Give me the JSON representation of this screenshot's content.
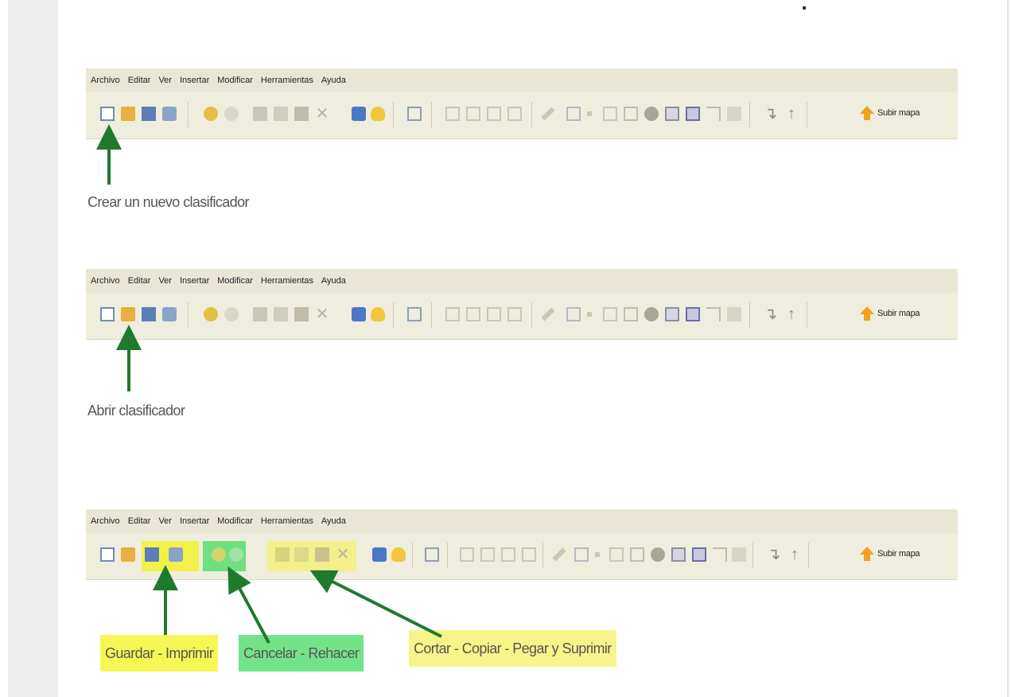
{
  "menu": [
    "Archivo",
    "Editar",
    "Ver",
    "Insertar",
    "Modificar",
    "Herramientas",
    "Ayuda"
  ],
  "toolbar": {
    "subir_label": "Subir mapa"
  },
  "captions": {
    "crear": "Crear un nuevo clasificador",
    "abrir": "Abrir clasificador",
    "guardar": "Guardar - Imprimir",
    "cancelar": "Cancelar - Rehacer",
    "cortar": "Cortar  - Copiar - Pegar y Suprimir"
  },
  "colors": {
    "highlight_yellow": "#f1f14a",
    "highlight_green": "#6fe07f",
    "highlight_pale_yellow": "#f3ef8a",
    "arrow_green": "#1f7a2e",
    "toolbar_bg": "#efeddd"
  },
  "icons": [
    "new-icon",
    "open-folder-icon",
    "save-icon",
    "print-icon",
    "undo-icon",
    "redo-icon",
    "cut-icon",
    "copy-icon",
    "paste-icon",
    "delete-icon",
    "monitor-icon",
    "lightbulb-icon",
    "image-icon",
    "node-icon",
    "node-branch-icon",
    "node-list-icon",
    "node-tree-icon",
    "pencil-icon",
    "picture-icon",
    "dot-icon",
    "table-icon",
    "note-icon",
    "globe-icon",
    "grid-icon",
    "list-icon",
    "connect-icon",
    "close-small-icon",
    "arrow-down-icon",
    "arrow-up-icon",
    "upload-arrow-icon"
  ]
}
